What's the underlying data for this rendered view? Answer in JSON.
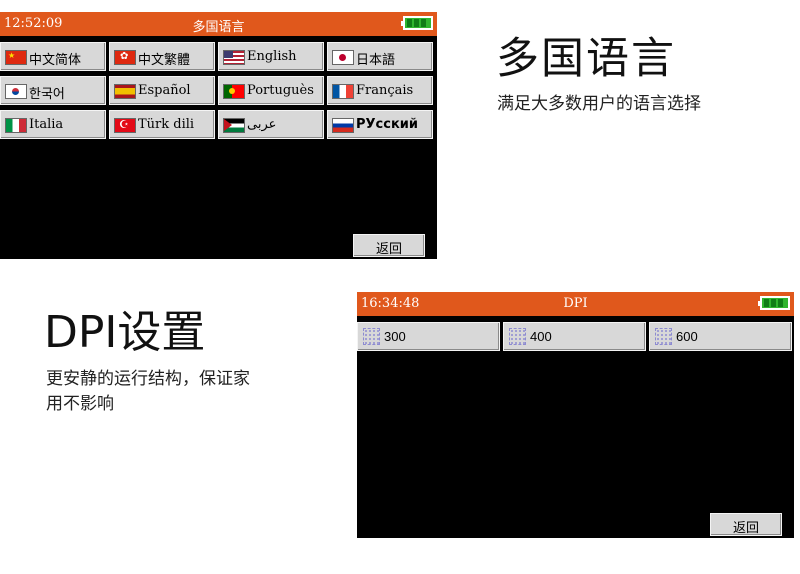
{
  "language_screen": {
    "time": "12:52:09",
    "title": "多国语言",
    "languages": [
      {
        "label": "中文简体",
        "flag": "cn"
      },
      {
        "label": "中文繁體",
        "flag": "hk"
      },
      {
        "label": "English",
        "flag": "us"
      },
      {
        "label": "日本語",
        "flag": "jp"
      },
      {
        "label": "한국어",
        "flag": "kr"
      },
      {
        "label": "Español",
        "flag": "es"
      },
      {
        "label": "Portuguès",
        "flag": "pt"
      },
      {
        "label": "Français",
        "flag": "fr"
      },
      {
        "label": "Italia",
        "flag": "it"
      },
      {
        "label": "Türk dili",
        "flag": "tr"
      },
      {
        "label": "عربى",
        "flag": "eh"
      },
      {
        "label": "РУсский",
        "flag": "ru"
      }
    ],
    "back_label": "返回"
  },
  "promo_language": {
    "heading": "多国语言",
    "subtext": "满足大多数用户的语言选择"
  },
  "dpi_screen": {
    "time": "16:34:48",
    "title": "DPI",
    "options": [
      {
        "label": "300"
      },
      {
        "label": "400"
      },
      {
        "label": "600"
      }
    ],
    "back_label": "返回"
  },
  "promo_dpi": {
    "heading": "DPI设置",
    "subtext_line1": "更安静的运行结构，保证家",
    "subtext_line2": "用不影响"
  },
  "colors": {
    "titlebar": "#e0581c",
    "screen_bg": "#000000",
    "button_face": "#d8d8d8",
    "battery_green": "#2fb52f"
  }
}
